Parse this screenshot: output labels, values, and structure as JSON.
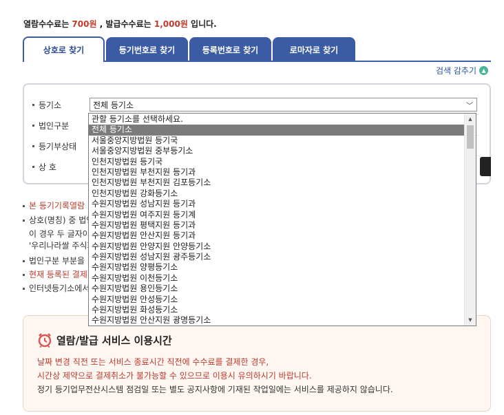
{
  "fee_notice": {
    "prefix": "열람수수료는 ",
    "view_fee": "700원",
    "middle": " , 발급수수료는 ",
    "issue_fee": "1,000원",
    "suffix": " 입니다."
  },
  "tabs": [
    {
      "label": "상호로 찾기",
      "active": true
    },
    {
      "label": "등기번호로 찾기",
      "active": false
    },
    {
      "label": "등록번호로 찾기",
      "active": false
    },
    {
      "label": "로마자로 찾기",
      "active": false
    }
  ],
  "collapse_search": {
    "label": "검색 감추기",
    "icon": "chevron-up-icon"
  },
  "form": {
    "registry_label": "등기소",
    "corp_type_label": "법인구분",
    "status_label": "등기부상태",
    "name_label": "상 호",
    "registry_selected": "전체 등기소"
  },
  "registry_options": {
    "selected_index": 1,
    "items": [
      "관할 등기소를 선택하세요.",
      "전체 등기소",
      "서울중앙지방법원 등기국",
      "서울중앙지방법원 중부등기소",
      "인천지방법원 등기국",
      "인천지방법원 부천지원 등기과",
      "인천지방법원 부천지원 김포등기소",
      "인천지방법원 강화등기소",
      "수원지방법원 성남지원 등기과",
      "수원지방법원 여주지원 등기계",
      "수원지방법원 평택지원 등기과",
      "수원지방법원 안산지원 등기과",
      "수원지방법원 안양지원 안양등기소",
      "수원지방법원 성남지원 광주등기소",
      "수원지방법원 양평등기소",
      "수원지방법원 이천등기소",
      "수원지방법원 용인등기소",
      "수원지방법원 안성등기소",
      "수원지방법원 화성등기소",
      "수원지방법원 안산지원 광명등기소"
    ]
  },
  "notes": [
    {
      "text": "본 등기기록열람 ",
      "red": true,
      "bullet": true
    },
    {
      "text": "상호(명칭) 중 법인",
      "red": false,
      "bullet": true
    },
    {
      "text": "이 경우 두 글자이",
      "red": false,
      "bullet": false
    },
    {
      "text": "'우리나라쌀 주식회",
      "red": false,
      "bullet": false
    },
    {
      "text": "법인구분 부분을 ",
      "red": false,
      "bullet": true
    },
    {
      "text": "현재 등록된 결제",
      "red": true,
      "bullet": true
    },
    {
      "text": "인터넷등기소에서",
      "red": false,
      "bullet": true
    }
  ],
  "service_hours": {
    "title": "열람/발급 서비스 이용시간",
    "icon": "alarm-clock-icon",
    "line1": "날짜 변경 직전 또는 서비스 종료시간 직전에 수수료를 결제한 경우,",
    "line2": "시간상 제약으로 결제취소가 불가능할 수 있으므로 이용시 유의하시기 바랍니다.",
    "line3": "정기 등기업무전산시스템 점검일 또는 별도 공지사항에 기재된 작업일에는 서비스를 제공하지 않습니다."
  },
  "colors": {
    "accent": "#3b5ba5",
    "red": "#c0392b",
    "teal": "#4bb39a"
  }
}
